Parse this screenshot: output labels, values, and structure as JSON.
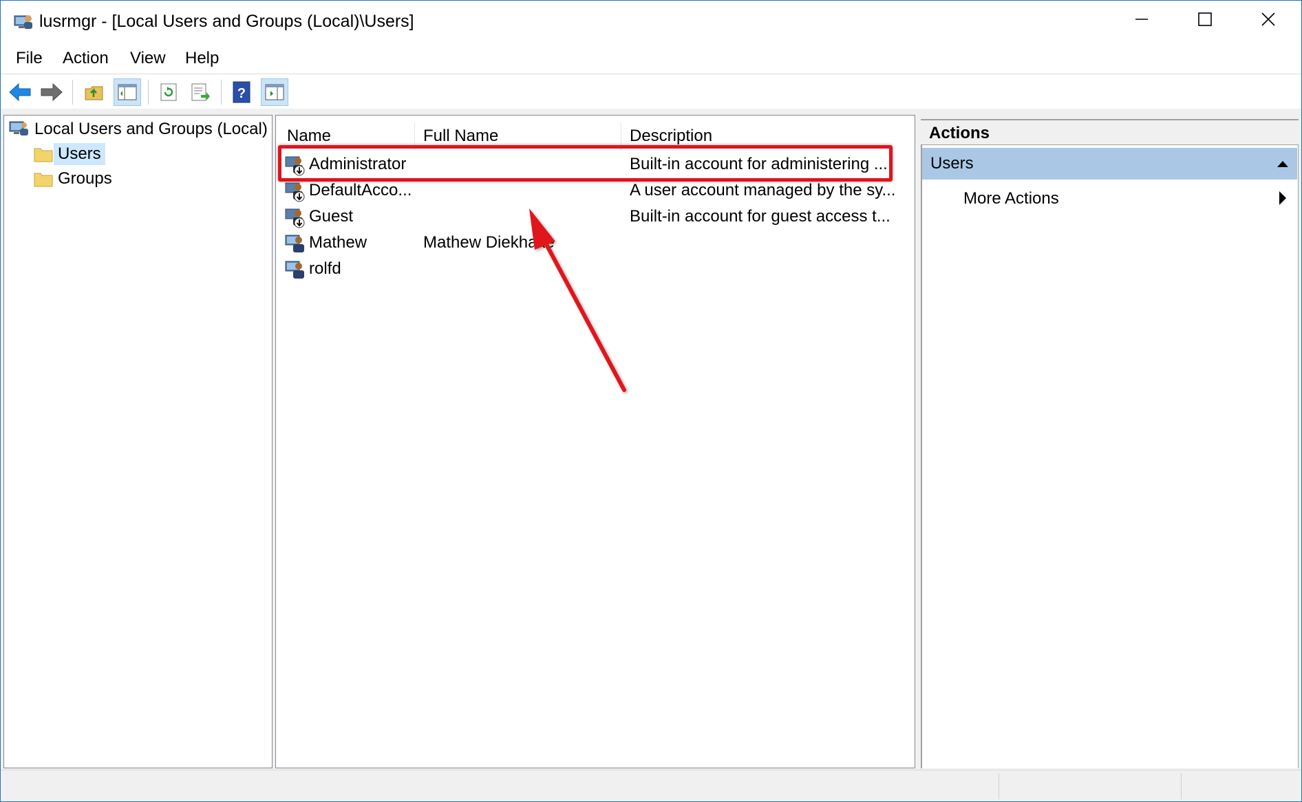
{
  "window": {
    "title": "lusrmgr - [Local Users and Groups (Local)\\Users]"
  },
  "menu": {
    "items": [
      {
        "label": "File"
      },
      {
        "label": "Action"
      },
      {
        "label": "View"
      },
      {
        "label": "Help"
      }
    ]
  },
  "toolbar": {
    "buttons": [
      {
        "icon": "back-arrow-icon"
      },
      {
        "icon": "forward-arrow-icon"
      },
      {
        "icon": "up-folder-icon"
      },
      {
        "icon": "show-hide-tree-icon"
      },
      {
        "icon": "refresh-icon"
      },
      {
        "icon": "export-list-icon"
      },
      {
        "icon": "help-icon"
      },
      {
        "icon": "show-hide-action-pane-icon"
      }
    ]
  },
  "tree": {
    "root": {
      "label": "Local Users and Groups (Local)",
      "icon": "computer-users-icon"
    },
    "children": [
      {
        "label": "Users",
        "icon": "folder-icon",
        "selected": true
      },
      {
        "label": "Groups",
        "icon": "folder-icon",
        "selected": false
      }
    ]
  },
  "list": {
    "columns": [
      "Name",
      "Full Name",
      "Description"
    ],
    "rows": [
      {
        "name": "Administrator",
        "full_name": "",
        "description": "Built-in account for administering ...",
        "icon": "disabled-user-icon"
      },
      {
        "name": "DefaultAcco...",
        "full_name": "",
        "description": "A user account managed by the sy...",
        "icon": "disabled-user-icon"
      },
      {
        "name": "Guest",
        "full_name": "",
        "description": "Built-in account for guest access t...",
        "icon": "disabled-user-icon"
      },
      {
        "name": "Mathew",
        "full_name": "Mathew Diekhake",
        "description": "",
        "icon": "user-icon"
      },
      {
        "name": "rolfd",
        "full_name": "",
        "description": "",
        "icon": "user-icon"
      }
    ]
  },
  "actions": {
    "title": "Actions",
    "group": "Users",
    "items": [
      {
        "label": "More Actions"
      }
    ]
  },
  "annotation": {
    "highlight_color": "#e0141e"
  }
}
